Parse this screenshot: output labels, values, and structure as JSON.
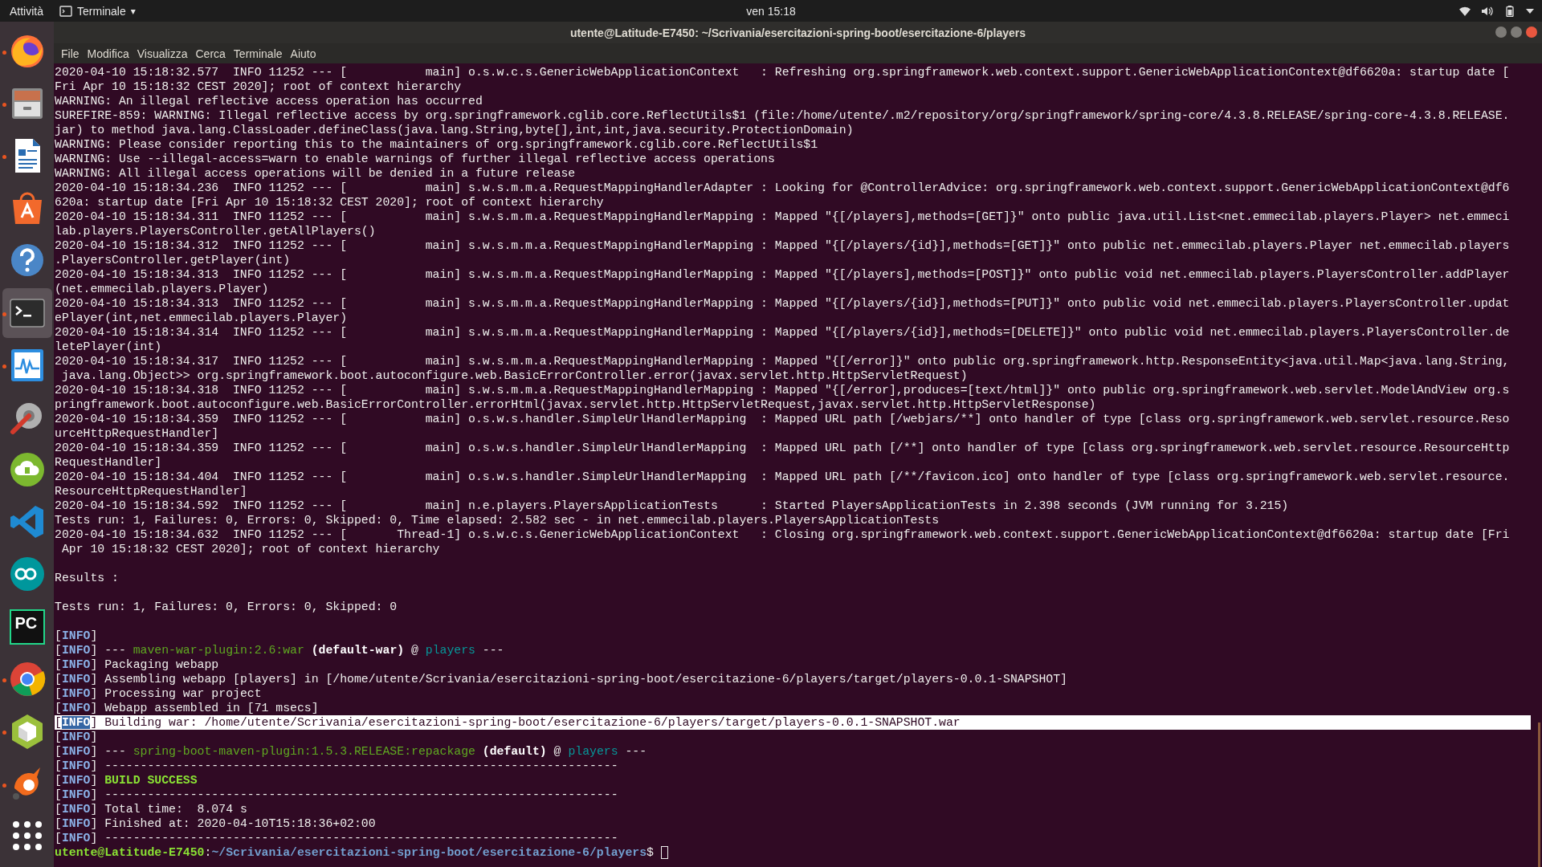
{
  "top_bar": {
    "activities": "Attività",
    "app_menu": "Terminale",
    "app_menu_caret": "▾",
    "clock": "ven 15:18"
  },
  "dock": [
    {
      "kind": "firefox",
      "running": true,
      "selected": false
    },
    {
      "kind": "files",
      "running": true,
      "selected": false
    },
    {
      "kind": "writer",
      "running": true,
      "selected": false
    },
    {
      "kind": "software",
      "running": false,
      "selected": false
    },
    {
      "kind": "help",
      "running": false,
      "selected": false
    },
    {
      "kind": "terminal",
      "running": true,
      "selected": true
    },
    {
      "kind": "monitor",
      "running": true,
      "selected": false
    },
    {
      "kind": "settings",
      "running": false,
      "selected": false
    },
    {
      "kind": "cloud",
      "running": false,
      "selected": false
    },
    {
      "kind": "vscode",
      "running": false,
      "selected": false
    },
    {
      "kind": "arduino",
      "running": false,
      "selected": false
    },
    {
      "kind": "pycharm",
      "running": false,
      "selected": false,
      "label": "PC"
    },
    {
      "kind": "chrome",
      "running": true,
      "selected": false
    },
    {
      "kind": "cube",
      "running": true,
      "selected": false
    },
    {
      "kind": "swirl",
      "running": true,
      "selected": false
    },
    {
      "kind": "grid",
      "running": false,
      "selected": false
    }
  ],
  "window": {
    "title": "utente@Latitude-E7450: ~/Scrivania/esercitazioni-spring-boot/esercitazione-6/players"
  },
  "menu": [
    "File",
    "Modifica",
    "Visualizza",
    "Cerca",
    "Terminale",
    "Aiuto"
  ],
  "lines": [
    {
      "kind": "log",
      "highlighted": false,
      "text": "2020-04-10 15:18:32.577  INFO 11252 --- [           main] o.s.w.c.s.GenericWebApplicationContext   : Refreshing org.springframework.web.context.support.GenericWebApplicationContext@df6620a: startup date ["
    },
    {
      "kind": "log",
      "highlighted": false,
      "text": "Fri Apr 10 15:18:32 CEST 2020]; root of context hierarchy"
    },
    {
      "kind": "log",
      "highlighted": false,
      "text": "WARNING: An illegal reflective access operation has occurred"
    },
    {
      "kind": "log",
      "highlighted": false,
      "text": "SUREFIRE-859: WARNING: Illegal reflective access by org.springframework.cglib.core.ReflectUtils$1 (file:/home/utente/.m2/repository/org/springframework/spring-core/4.3.8.RELEASE/spring-core-4.3.8.RELEASE."
    },
    {
      "kind": "log",
      "highlighted": false,
      "text": "jar) to method java.lang.ClassLoader.defineClass(java.lang.String,byte[],int,int,java.security.ProtectionDomain)"
    },
    {
      "kind": "log",
      "highlighted": false,
      "text": "WARNING: Please consider reporting this to the maintainers of org.springframework.cglib.core.ReflectUtils$1"
    },
    {
      "kind": "log",
      "highlighted": false,
      "text": "WARNING: Use --illegal-access=warn to enable warnings of further illegal reflective access operations"
    },
    {
      "kind": "log",
      "highlighted": false,
      "text": "WARNING: All illegal access operations will be denied in a future release"
    },
    {
      "kind": "log",
      "highlighted": false,
      "text": "2020-04-10 15:18:34.236  INFO 11252 --- [           main] s.w.s.m.m.a.RequestMappingHandlerAdapter : Looking for @ControllerAdvice: org.springframework.web.context.support.GenericWebApplicationContext@df6"
    },
    {
      "kind": "log",
      "highlighted": false,
      "text": "620a: startup date [Fri Apr 10 15:18:32 CEST 2020]; root of context hierarchy"
    },
    {
      "kind": "log",
      "highlighted": false,
      "text": "2020-04-10 15:18:34.311  INFO 11252 --- [           main] s.w.s.m.m.a.RequestMappingHandlerMapping : Mapped \"{[/players],methods=[GET]}\" onto public java.util.List<net.emmecilab.players.Player> net.emmeci"
    },
    {
      "kind": "log",
      "highlighted": false,
      "text": "lab.players.PlayersController.getAllPlayers()"
    },
    {
      "kind": "log",
      "highlighted": false,
      "text": "2020-04-10 15:18:34.312  INFO 11252 --- [           main] s.w.s.m.m.a.RequestMappingHandlerMapping : Mapped \"{[/players/{id}],methods=[GET]}\" onto public net.emmecilab.players.Player net.emmecilab.players"
    },
    {
      "kind": "log",
      "highlighted": false,
      "text": ".PlayersController.getPlayer(int)"
    },
    {
      "kind": "log",
      "highlighted": false,
      "text": "2020-04-10 15:18:34.313  INFO 11252 --- [           main] s.w.s.m.m.a.RequestMappingHandlerMapping : Mapped \"{[/players],methods=[POST]}\" onto public void net.emmecilab.players.PlayersController.addPlayer"
    },
    {
      "kind": "log",
      "highlighted": false,
      "text": "(net.emmecilab.players.Player)"
    },
    {
      "kind": "log",
      "highlighted": false,
      "text": "2020-04-10 15:18:34.313  INFO 11252 --- [           main] s.w.s.m.m.a.RequestMappingHandlerMapping : Mapped \"{[/players/{id}],methods=[PUT]}\" onto public void net.emmecilab.players.PlayersController.updat"
    },
    {
      "kind": "log",
      "highlighted": false,
      "text": "ePlayer(int,net.emmecilab.players.Player)"
    },
    {
      "kind": "log",
      "highlighted": false,
      "text": "2020-04-10 15:18:34.314  INFO 11252 --- [           main] s.w.s.m.m.a.RequestMappingHandlerMapping : Mapped \"{[/players/{id}],methods=[DELETE]}\" onto public void net.emmecilab.players.PlayersController.de"
    },
    {
      "kind": "log",
      "highlighted": false,
      "text": "letePlayer(int)"
    },
    {
      "kind": "log",
      "highlighted": false,
      "text": "2020-04-10 15:18:34.317  INFO 11252 --- [           main] s.w.s.m.m.a.RequestMappingHandlerMapping : Mapped \"{[/error]}\" onto public org.springframework.http.ResponseEntity<java.util.Map<java.lang.String,"
    },
    {
      "kind": "log",
      "highlighted": false,
      "text": " java.lang.Object>> org.springframework.boot.autoconfigure.web.BasicErrorController.error(javax.servlet.http.HttpServletRequest)"
    },
    {
      "kind": "log",
      "highlighted": false,
      "text": "2020-04-10 15:18:34.318  INFO 11252 --- [           main] s.w.s.m.m.a.RequestMappingHandlerMapping : Mapped \"{[/error],produces=[text/html]}\" onto public org.springframework.web.servlet.ModelAndView org.s"
    },
    {
      "kind": "log",
      "highlighted": false,
      "text": "pringframework.boot.autoconfigure.web.BasicErrorController.errorHtml(javax.servlet.http.HttpServletRequest,javax.servlet.http.HttpServletResponse)"
    },
    {
      "kind": "log",
      "highlighted": false,
      "text": "2020-04-10 15:18:34.359  INFO 11252 --- [           main] o.s.w.s.handler.SimpleUrlHandlerMapping  : Mapped URL path [/webjars/**] onto handler of type [class org.springframework.web.servlet.resource.Reso"
    },
    {
      "kind": "log",
      "highlighted": false,
      "text": "urceHttpRequestHandler]"
    },
    {
      "kind": "log",
      "highlighted": false,
      "text": "2020-04-10 15:18:34.359  INFO 11252 --- [           main] o.s.w.s.handler.SimpleUrlHandlerMapping  : Mapped URL path [/**] onto handler of type [class org.springframework.web.servlet.resource.ResourceHttp"
    },
    {
      "kind": "log",
      "highlighted": false,
      "text": "RequestHandler]"
    },
    {
      "kind": "log",
      "highlighted": false,
      "text": "2020-04-10 15:18:34.404  INFO 11252 --- [           main] o.s.w.s.handler.SimpleUrlHandlerMapping  : Mapped URL path [/**/favicon.ico] onto handler of type [class org.springframework.web.servlet.resource."
    },
    {
      "kind": "log",
      "highlighted": false,
      "text": "ResourceHttpRequestHandler]"
    },
    {
      "kind": "log",
      "highlighted": false,
      "text": "2020-04-10 15:18:34.592  INFO 11252 --- [           main] n.e.players.PlayersApplicationTests      : Started PlayersApplicationTests in 2.398 seconds (JVM running for 3.215)"
    },
    {
      "kind": "log",
      "highlighted": false,
      "text": "Tests run: 1, Failures: 0, Errors: 0, Skipped: 0, Time elapsed: 2.582 sec - in net.emmecilab.players.PlayersApplicationTests"
    },
    {
      "kind": "log",
      "highlighted": false,
      "text": "2020-04-10 15:18:34.632  INFO 11252 --- [       Thread-1] o.s.w.c.s.GenericWebApplicationContext   : Closing org.springframework.web.context.support.GenericWebApplicationContext@df6620a: startup date [Fri"
    },
    {
      "kind": "log",
      "highlighted": false,
      "text": " Apr 10 15:18:32 CEST 2020]; root of context hierarchy"
    },
    {
      "kind": "blank"
    },
    {
      "kind": "log",
      "highlighted": false,
      "text": "Results :"
    },
    {
      "kind": "blank"
    },
    {
      "kind": "log",
      "highlighted": false,
      "text": "Tests run: 1, Failures: 0, Errors: 0, Skipped: 0"
    },
    {
      "kind": "blank"
    },
    {
      "kind": "log",
      "highlighted": false,
      "parts": [
        {
          "kind": "plain",
          "text": "["
        },
        {
          "kind": "tag",
          "text": "INFO"
        },
        {
          "kind": "plain",
          "text": "]"
        }
      ]
    },
    {
      "kind": "log",
      "highlighted": false,
      "parts": [
        {
          "kind": "plain",
          "text": "["
        },
        {
          "kind": "tag",
          "text": "INFO"
        },
        {
          "kind": "plain",
          "text": "] --- "
        },
        {
          "kind": "plugin",
          "text": "maven-war-plugin:2.6:war "
        },
        {
          "kind": "bold",
          "text": "(default-war)"
        },
        {
          "kind": "plain",
          "text": " @ "
        },
        {
          "kind": "project",
          "text": "players"
        },
        {
          "kind": "plain",
          "text": " ---"
        }
      ]
    },
    {
      "kind": "log",
      "highlighted": false,
      "parts": [
        {
          "kind": "plain",
          "text": "["
        },
        {
          "kind": "tag",
          "text": "INFO"
        },
        {
          "kind": "plain",
          "text": "] Packaging webapp"
        }
      ]
    },
    {
      "kind": "log",
      "highlighted": false,
      "parts": [
        {
          "kind": "plain",
          "text": "["
        },
        {
          "kind": "tag",
          "text": "INFO"
        },
        {
          "kind": "plain",
          "text": "] Assembling webapp [players] in [/home/utente/Scrivania/esercitazioni-spring-boot/esercitazione-6/players/target/players-0.0.1-SNAPSHOT]"
        }
      ]
    },
    {
      "kind": "log",
      "highlighted": false,
      "parts": [
        {
          "kind": "plain",
          "text": "["
        },
        {
          "kind": "tag",
          "text": "INFO"
        },
        {
          "kind": "plain",
          "text": "] Processing war project"
        }
      ]
    },
    {
      "kind": "log",
      "highlighted": false,
      "parts": [
        {
          "kind": "plain",
          "text": "["
        },
        {
          "kind": "tag",
          "text": "INFO"
        },
        {
          "kind": "plain",
          "text": "] Webapp assembled in [71 msecs]"
        }
      ]
    },
    {
      "kind": "log",
      "highlighted": true,
      "parts": [
        {
          "kind": "plain",
          "text": "["
        },
        {
          "kind": "tag",
          "text": "INFO"
        },
        {
          "kind": "plain",
          "text": "] Building war: /home/utente/Scrivania/esercitazioni-spring-boot/esercitazione-6/players/target/players-0.0.1-SNAPSHOT.war"
        }
      ]
    },
    {
      "kind": "log",
      "highlighted": false,
      "parts": [
        {
          "kind": "plain",
          "text": "["
        },
        {
          "kind": "tag",
          "text": "INFO"
        },
        {
          "kind": "plain",
          "text": "]"
        }
      ]
    },
    {
      "kind": "log",
      "highlighted": false,
      "parts": [
        {
          "kind": "plain",
          "text": "["
        },
        {
          "kind": "tag",
          "text": "INFO"
        },
        {
          "kind": "plain",
          "text": "] --- "
        },
        {
          "kind": "plugin",
          "text": "spring-boot-maven-plugin:1.5.3.RELEASE:repackage "
        },
        {
          "kind": "bold",
          "text": "(default)"
        },
        {
          "kind": "plain",
          "text": " @ "
        },
        {
          "kind": "project",
          "text": "players"
        },
        {
          "kind": "plain",
          "text": " ---"
        }
      ]
    },
    {
      "kind": "log",
      "highlighted": false,
      "parts": [
        {
          "kind": "plain",
          "text": "["
        },
        {
          "kind": "tag",
          "text": "INFO"
        },
        {
          "kind": "plain",
          "text": "] ------------------------------------------------------------------------"
        }
      ]
    },
    {
      "kind": "log",
      "highlighted": false,
      "parts": [
        {
          "kind": "plain",
          "text": "["
        },
        {
          "kind": "tag",
          "text": "INFO"
        },
        {
          "kind": "plain",
          "text": "] "
        },
        {
          "kind": "success",
          "text": "BUILD SUCCESS"
        }
      ]
    },
    {
      "kind": "log",
      "highlighted": false,
      "parts": [
        {
          "kind": "plain",
          "text": "["
        },
        {
          "kind": "tag",
          "text": "INFO"
        },
        {
          "kind": "plain",
          "text": "] ------------------------------------------------------------------------"
        }
      ]
    },
    {
      "kind": "log",
      "highlighted": false,
      "parts": [
        {
          "kind": "plain",
          "text": "["
        },
        {
          "kind": "tag",
          "text": "INFO"
        },
        {
          "kind": "plain",
          "text": "] Total time:  8.074 s"
        }
      ]
    },
    {
      "kind": "log",
      "highlighted": false,
      "parts": [
        {
          "kind": "plain",
          "text": "["
        },
        {
          "kind": "tag",
          "text": "INFO"
        },
        {
          "kind": "plain",
          "text": "] Finished at: 2020-04-10T15:18:36+02:00"
        }
      ]
    },
    {
      "kind": "log",
      "highlighted": false,
      "parts": [
        {
          "kind": "plain",
          "text": "["
        },
        {
          "kind": "tag",
          "text": "INFO"
        },
        {
          "kind": "plain",
          "text": "] ------------------------------------------------------------------------"
        }
      ]
    },
    {
      "kind": "prompt",
      "parts": [
        {
          "kind": "user",
          "text": "utente@Latitude-E7450"
        },
        {
          "kind": "plain",
          "text": ":"
        },
        {
          "kind": "path",
          "text": "~/Scrivania/esercitazioni-spring-boot/esercitazione-6/players"
        },
        {
          "kind": "plain",
          "text": "$ "
        }
      ]
    }
  ]
}
